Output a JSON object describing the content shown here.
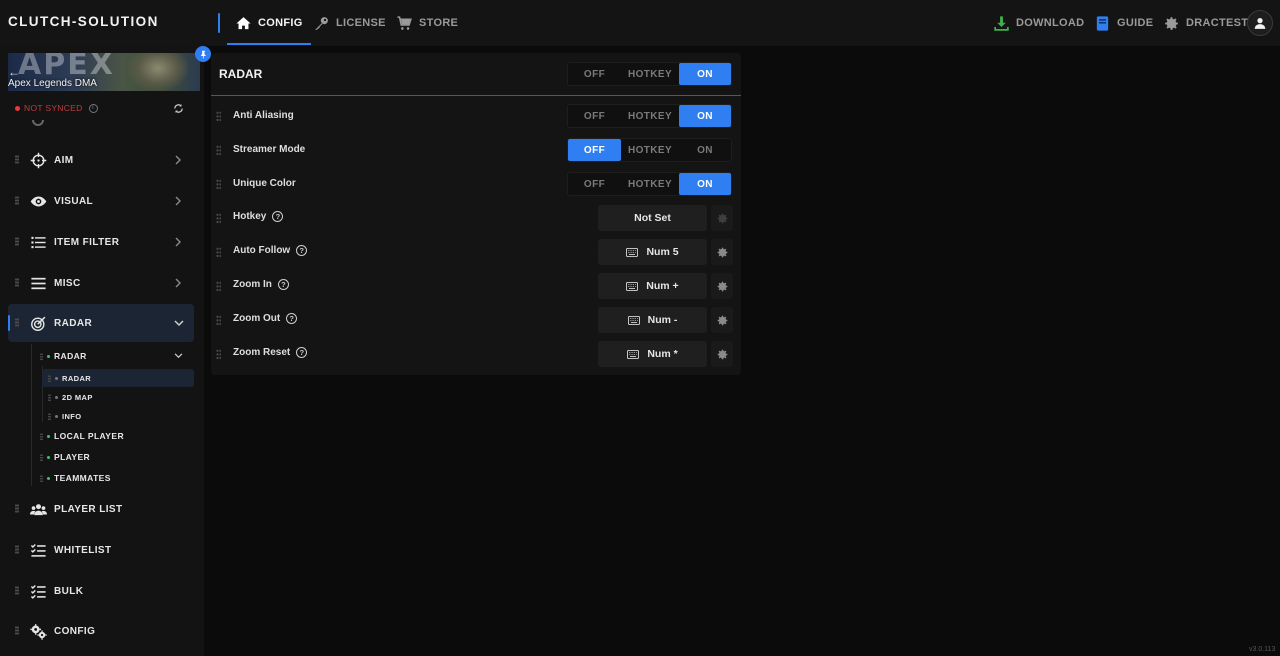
{
  "brand": "CLUTCH-SOLUTION",
  "nav": {
    "config": "CONFIG",
    "license": "LICENSE",
    "store": "STORE",
    "download": "DOWNLOAD",
    "guide": "GUIDE",
    "user": "DRACTEST"
  },
  "colors": {
    "accent": "#2f7ff2",
    "download_icon": "#3bb34a",
    "guide_icon": "#2f7ff2",
    "not_synced": "#e53b3b",
    "synced_dot": "#3ac36b"
  },
  "banner": {
    "game_title": "APEX",
    "label": "Apex Legends DMA",
    "back_glyph": "←"
  },
  "sync": {
    "status": "NOT SYNCED"
  },
  "sidebar": {
    "items": [
      {
        "label": "AIM",
        "icon": "crosshair-icon"
      },
      {
        "label": "VISUAL",
        "icon": "eye-icon"
      },
      {
        "label": "ITEM FILTER",
        "icon": "list-icon"
      },
      {
        "label": "MISC",
        "icon": "menu-icon"
      },
      {
        "label": "RADAR",
        "icon": "radar-icon"
      },
      {
        "label": "PLAYER LIST",
        "icon": "users-icon"
      },
      {
        "label": "WHITELIST",
        "icon": "checklist-icon"
      },
      {
        "label": "BULK",
        "icon": "checklist-icon"
      },
      {
        "label": "CONFIG",
        "icon": "gears-icon"
      }
    ],
    "radar_sub": {
      "label": "RADAR",
      "children": [
        "RADAR",
        "2D MAP",
        "INFO"
      ],
      "siblings": [
        "LOCAL PLAYER",
        "PLAYER",
        "TEAMMATES"
      ]
    }
  },
  "panel": {
    "title": "RADAR",
    "options": {
      "off": "OFF",
      "hotkey": "HOTKEY",
      "on": "ON"
    },
    "master_state": "ON",
    "toggles": [
      {
        "label": "Anti Aliasing",
        "state": "ON"
      },
      {
        "label": "Streamer Mode",
        "state": "OFF"
      },
      {
        "label": "Unique Color",
        "state": "ON"
      }
    ],
    "keys": [
      {
        "label": "Hotkey",
        "value": "Not Set",
        "has_kbd_icon": false
      },
      {
        "label": "Auto Follow",
        "value": "Num 5",
        "has_kbd_icon": true
      },
      {
        "label": "Zoom In",
        "value": "Num +",
        "has_kbd_icon": true
      },
      {
        "label": "Zoom Out",
        "value": "Num -",
        "has_kbd_icon": true
      },
      {
        "label": "Zoom Reset",
        "value": "Num *",
        "has_kbd_icon": true
      }
    ]
  },
  "help_glyph": "?",
  "info_glyph": "i",
  "version": "v3.0.113"
}
